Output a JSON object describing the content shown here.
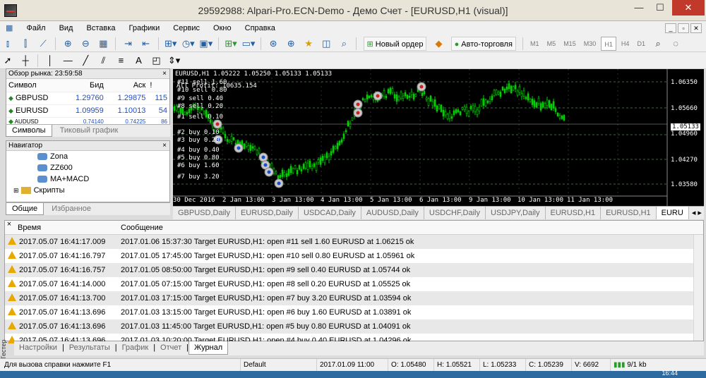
{
  "window": {
    "title": "29592988: Alpari-Pro.ECN-Demo - Демо Счет - [EURUSD,H1 (visual)]",
    "minimize": "—",
    "maximize": "☐",
    "close": "✕"
  },
  "menu": [
    "Файл",
    "Вид",
    "Вставка",
    "Графики",
    "Сервис",
    "Окно",
    "Справка"
  ],
  "toolbar": {
    "new_order": "Новый ордер",
    "autotrading": "Авто-торговля",
    "timeframes": [
      "M1",
      "M5",
      "M15",
      "M30",
      "H1",
      "H4",
      "D1"
    ],
    "active_timeframe": "H1"
  },
  "market_watch": {
    "title": "Обзор рынка: 23:59:58",
    "columns": [
      "Символ",
      "Бид",
      "Аск",
      "!"
    ],
    "rows": [
      {
        "symbol": "GBPUSD",
        "bid": "1.29760",
        "ask": "1.29875",
        "spread": "115"
      },
      {
        "symbol": "EURUSD",
        "bid": "1.09959",
        "ask": "1.10013",
        "spread": "54"
      },
      {
        "symbol": "AUDUSD",
        "bid": "0.74140",
        "ask": "0.74225",
        "spread": "86"
      }
    ],
    "tabs": [
      "Символы",
      "Тиковый график"
    ]
  },
  "navigator": {
    "title": "Навигатор",
    "items": [
      "Zona",
      "ZZ600",
      "MA+MACD",
      "Скрипты"
    ],
    "tabs": [
      "Общие",
      "Избранное"
    ]
  },
  "chart": {
    "header": "EURUSD,H1  1.05222 1.05250 1.05133 1.05133",
    "profit_label": "All Profit: 10635.154",
    "price_ticks": [
      "1.06350",
      "1.05660",
      "1.05133",
      "1.04960",
      "1.04270",
      "1.03580"
    ],
    "current_price": "1.05133",
    "time_ticks": [
      "30 Dec 2016",
      "2 Jan 13:00",
      "3 Jan 13:00",
      "4 Jan 13:00",
      "5 Jan 13:00",
      "6 Jan 13:00",
      "9 Jan 13:00",
      "10 Jan 13:00",
      "11 Jan 13:00"
    ],
    "order_labels": [
      "#11 sell 1.60",
      "#10 sell 0.80",
      "#9 sell 0.40",
      "#8 sell 0.20",
      "#1 sell 0.10",
      "#2 buy 0.10",
      "#3 buy 0.20",
      "#4 buy 0.40",
      "#5 buy 0.80",
      "#6 buy 1.60",
      "#7 buy 3.20"
    ],
    "colors": {
      "background": "#000000",
      "candles": "#00d000",
      "grid": "#3a6a3a",
      "labels": "#ffffff"
    }
  },
  "chart_tabs": [
    "GBPUSD,Daily",
    "EURUSD,Daily",
    "USDCAD,Daily",
    "AUDUSD,Daily",
    "USDCHF,Daily",
    "USDJPY,Daily",
    "EURUSD,H1",
    "EURUSD,H1",
    "EURU"
  ],
  "journal": {
    "columns": [
      "Время",
      "Сообщение"
    ],
    "rows": [
      {
        "time": "2017.05.07 16:41:17.009",
        "message": "2017.01.06 15:37:30  Target EURUSD,H1: open #11 sell 1.60 EURUSD at 1.06215 ok"
      },
      {
        "time": "2017.05.07 16:41:16.797",
        "message": "2017.01.05 17:45:00  Target EURUSD,H1: open #10 sell 0.80 EURUSD at 1.05961 ok"
      },
      {
        "time": "2017.05.07 16:41:16.757",
        "message": "2017.01.05 08:50:00  Target EURUSD,H1: open #9 sell 0.40 EURUSD at 1.05744 ok"
      },
      {
        "time": "2017.05.07 16:41:14.000",
        "message": "2017.01.05 07:15:00  Target EURUSD,H1: open #8 sell 0.20 EURUSD at 1.05525 ok"
      },
      {
        "time": "2017.05.07 16:41:13.700",
        "message": "2017.01.03 17:15:00  Target EURUSD,H1: open #7 buy 3.20 EURUSD at 1.03594 ok"
      },
      {
        "time": "2017.05.07 16:41:13.696",
        "message": "2017.01.03 13:15:00  Target EURUSD,H1: open #6 buy 1.60 EURUSD at 1.03891 ok"
      },
      {
        "time": "2017.05.07 16:41:13.696",
        "message": "2017.01.03 11:45:00  Target EURUSD,H1: open #5 buy 0.80 EURUSD at 1.04091 ok"
      },
      {
        "time": "2017.05.07 16:41:13.696",
        "message": "2017.01.03 10:20:00  Target EURUSD,H1: open #4 buy 0.40 EURUSD at 1.04296 ok"
      }
    ]
  },
  "tester": {
    "side_label": "Тестер",
    "tabs": [
      "Настройки",
      "Результаты",
      "График",
      "Отчет",
      "Журнал"
    ],
    "active_tab": "Журнал"
  },
  "status": {
    "help": "Для вызова справки нажмите F1",
    "profile": "Default",
    "time": "2017.01.09 11:00",
    "open": "O: 1.05480",
    "high": "H: 1.05521",
    "low": "L: 1.05233",
    "close": "C: 1.05239",
    "volume": "V: 6692",
    "traffic": "9/1 kb"
  },
  "taskbar": {
    "clock": "16:44"
  }
}
